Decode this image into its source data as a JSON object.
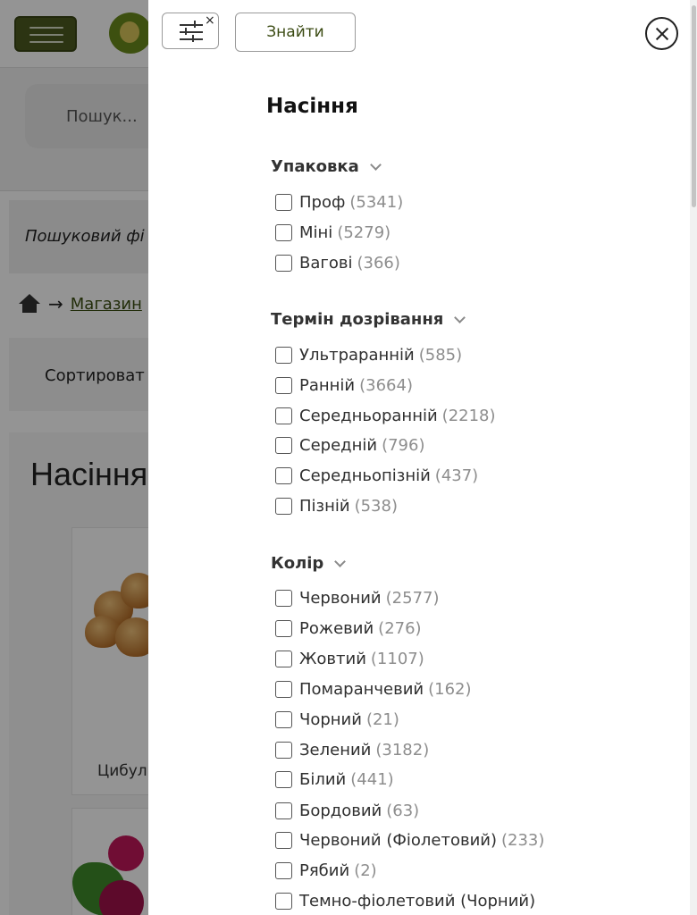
{
  "background_page": {
    "search_placeholder": "Пошук...",
    "filter_bar_text": "Пошуковий фі",
    "breadcrumb_link": "Магазин",
    "breadcrumb_arrow": "→",
    "sort_text": "Сортироват",
    "page_title": "Насіння",
    "card1_name": "Цибул",
    "brand_color": "#4d5a1f"
  },
  "panel": {
    "find_label": "Знайти",
    "reset_icon": "filter-reset-icon",
    "close_icon": "close-icon",
    "title": "Насіння",
    "groups": [
      {
        "title": "Упаковка",
        "options": [
          {
            "label": "Проф",
            "count": "(5341)"
          },
          {
            "label": "Міні",
            "count": "(5279)"
          },
          {
            "label": "Вагові",
            "count": "(366)"
          }
        ]
      },
      {
        "title": "Термін дозрівання",
        "options": [
          {
            "label": "Ультраранній",
            "count": "(585)"
          },
          {
            "label": "Ранній",
            "count": "(3664)"
          },
          {
            "label": "Середньоранній",
            "count": "(2218)"
          },
          {
            "label": "Середній",
            "count": "(796)"
          },
          {
            "label": "Середньопізній",
            "count": "(437)"
          },
          {
            "label": "Пізній",
            "count": "(538)"
          }
        ]
      },
      {
        "title": "Колір",
        "options": [
          {
            "label": "Червоний",
            "count": "(2577)"
          },
          {
            "label": "Рожевий",
            "count": "(276)"
          },
          {
            "label": "Жовтий",
            "count": "(1107)"
          },
          {
            "label": "Помаранчевий",
            "count": "(162)"
          },
          {
            "label": "Чорний",
            "count": "(21)"
          },
          {
            "label": "Зелений",
            "count": "(3182)"
          },
          {
            "label": "Білий",
            "count": "(441)"
          },
          {
            "label": "Бордовий",
            "count": "(63)"
          },
          {
            "label": "Червоний (Фіолетовий)",
            "count": "(233)"
          },
          {
            "label": "Рябий",
            "count": "(2)"
          },
          {
            "label": "Темно-фіолетовий (Чорний)",
            "count": ""
          }
        ]
      }
    ]
  }
}
